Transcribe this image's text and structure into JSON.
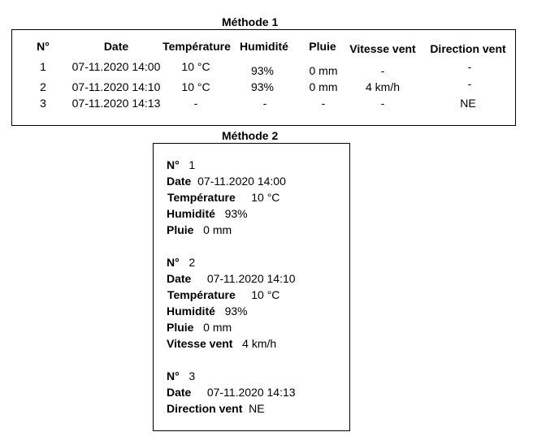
{
  "method1": {
    "title": "Méthode 1",
    "headers": [
      "N°",
      "Date",
      "Température",
      "Humidité",
      "Pluie",
      "Vitesse vent",
      "Direction vent"
    ],
    "rows": [
      [
        "1",
        "07-11.2020 14:00",
        "10 °C",
        "93%",
        "0 mm",
        "-",
        "-"
      ],
      [
        "2",
        "07-11.2020 14:10",
        "10 °C",
        "93%",
        "0 mm",
        "4 km/h",
        "-"
      ],
      [
        "3",
        "07-11.2020 14:13",
        "-",
        "-",
        "-",
        "-",
        "NE"
      ]
    ]
  },
  "method2": {
    "title": "Méthode 2",
    "records": [
      {
        "fields": [
          {
            "label": "N°",
            "value": "1"
          },
          {
            "label": "Date",
            "value": "07-11.2020 14:00"
          },
          {
            "label": "Température",
            "value": "10 °C"
          },
          {
            "label": "Humidité",
            "value": "93%"
          },
          {
            "label": "Pluie",
            "value": "0 mm"
          }
        ]
      },
      {
        "fields": [
          {
            "label": "N°",
            "value": "2"
          },
          {
            "label": "Date",
            "value": "07-11.2020 14:10"
          },
          {
            "label": "Température",
            "value": "10 °C"
          },
          {
            "label": "Humidité",
            "value": "93%"
          },
          {
            "label": "Pluie",
            "value": "0 mm"
          },
          {
            "label": "Vitesse vent",
            "value": "4 km/h"
          }
        ]
      },
      {
        "fields": [
          {
            "label": "N°",
            "value": "3"
          },
          {
            "label": "Date",
            "value": "07-11.2020 14:13"
          },
          {
            "label": "Direction vent",
            "value": "NE"
          }
        ]
      }
    ]
  }
}
